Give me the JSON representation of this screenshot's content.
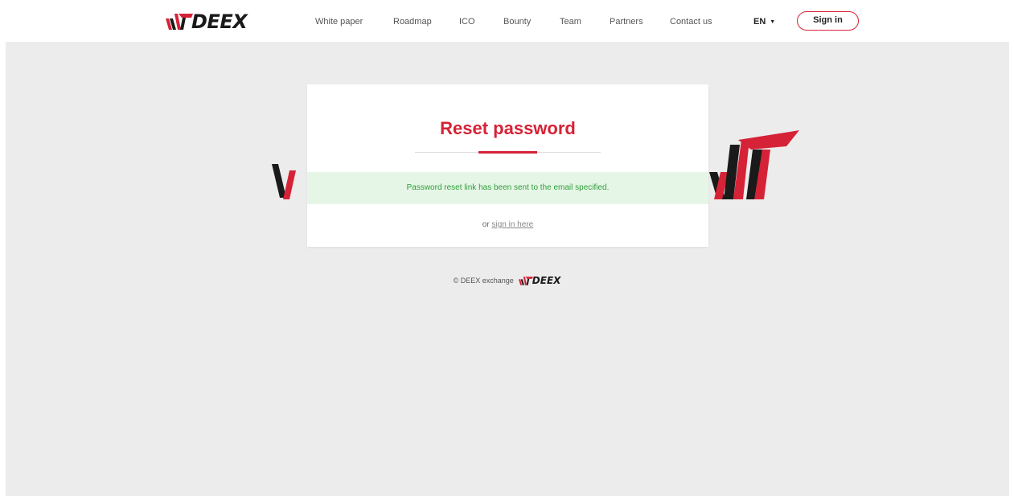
{
  "header": {
    "logo_text": "DEEX",
    "nav": [
      {
        "label": "White paper"
      },
      {
        "label": "Roadmap"
      },
      {
        "label": "ICO"
      },
      {
        "label": "Bounty"
      },
      {
        "label": "Team"
      },
      {
        "label": "Partners"
      },
      {
        "label": "Contact us"
      }
    ],
    "language": "EN",
    "language_caret": "▼",
    "signin_label": "Sign in"
  },
  "card": {
    "title": "Reset password",
    "alert_message": "Password reset link has been sent to the email specified.",
    "signin_prefix": "or",
    "signin_link": "sign in here"
  },
  "footer": {
    "text": "© DEEX exchange",
    "logo_text": "DEEX"
  },
  "colors": {
    "brand_red": "#d62236",
    "brand_black": "#1a1a1a",
    "alert_bg": "#e6f6e6",
    "alert_text": "#2e9e3a",
    "page_bg": "#ececec"
  },
  "icons": {
    "logo_mark": "deex-wt-mark-icon",
    "dropdown_caret": "caret-down-icon"
  }
}
